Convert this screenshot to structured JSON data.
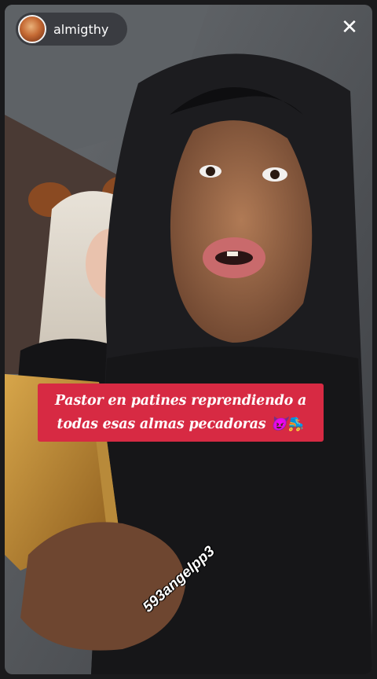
{
  "header": {
    "username": "almigthy",
    "avatar_icon": "profile-avatar",
    "close_icon": "close-icon"
  },
  "video": {
    "caption_line1": "Pastor en patines reprendiendo a",
    "caption_line2": "todas esas almas pecadoras 😈🛼",
    "watermark": "593angelpp3"
  },
  "colors": {
    "caption_bg": "#d72a43",
    "text": "#ffffff"
  }
}
